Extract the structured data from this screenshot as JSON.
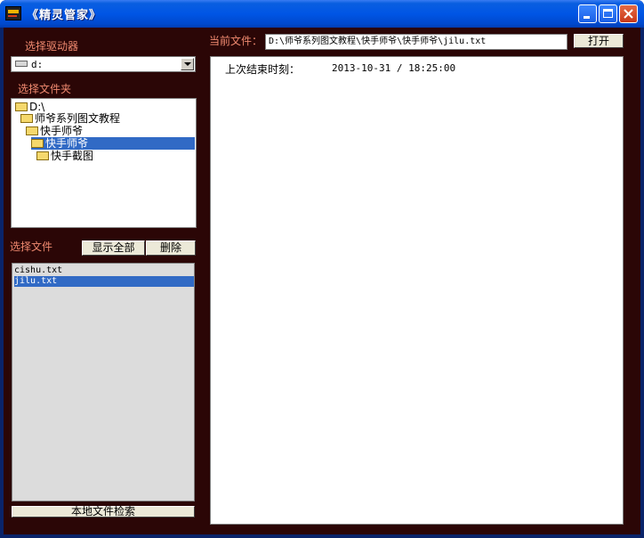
{
  "window": {
    "title": "《精灵管家》"
  },
  "drive": {
    "label": "选择驱动器",
    "value": "d:"
  },
  "folders": {
    "label": "选择文件夹",
    "items": [
      {
        "name": "D:\\",
        "level": 0,
        "selected": false
      },
      {
        "name": "师爷系列图文教程",
        "level": 1,
        "selected": false
      },
      {
        "name": "快手师爷",
        "level": 2,
        "selected": false
      },
      {
        "name": "快手师爷",
        "level": 3,
        "selected": true
      },
      {
        "name": "快手截图",
        "level": 4,
        "selected": false
      }
    ]
  },
  "files": {
    "label": "选择文件",
    "show_all_label": "显示全部",
    "delete_label": "删除",
    "items": [
      {
        "name": "cishu.txt",
        "selected": false
      },
      {
        "name": "jilu.txt",
        "selected": true
      }
    ],
    "search_label": "本地文件检索"
  },
  "current_file": {
    "label": "当前文件：",
    "path": "D:\\师爷系列图文教程\\快手师爷\\快手师爷\\jilu.txt",
    "open_label": "打开"
  },
  "content": {
    "label": "上次结束时刻：",
    "value": "2013-10-31 / 18:25:00"
  }
}
